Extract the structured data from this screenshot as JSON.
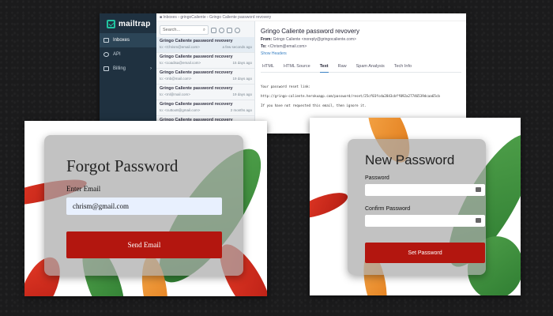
{
  "mailtrap": {
    "logo_text": "mailtrap",
    "breadcrumb": "■  Inboxes  ›  gringoCaliente  ›  Gringo Caliente password revovery",
    "nav": [
      {
        "label": "Inboxes"
      },
      {
        "label": "API"
      },
      {
        "label": "Billing"
      }
    ],
    "search_placeholder": "Search...",
    "messages": [
      {
        "subject": "Gringo Caliente password revovery",
        "to": "to: <Chrism@email.com>",
        "time": "a few seconds ago"
      },
      {
        "subject": "Gringo Caliente password recovery",
        "to": "to: <coadisa@email.com>",
        "time": "15 days ago"
      },
      {
        "subject": "Gringo Caliente password recovery",
        "to": "to: <mb@mail.com>",
        "time": "19 days ago"
      },
      {
        "subject": "Gringo Caliente password recovery",
        "to": "to: <ml@mail.com>",
        "time": "19 days ago"
      },
      {
        "subject": "Gringo Caliente password recovery",
        "to": "to: <cuttoo8@gmail.com>",
        "time": "2 months ago"
      },
      {
        "subject": "Gringo Caliente password recovery",
        "to": "",
        "time": ""
      }
    ],
    "detail": {
      "subject": "Gringo Caliente password revovery",
      "from_label": "From:",
      "from_value": "Gringo Caliente <noreply@gringocaliente.com>",
      "to_label": "To:",
      "to_value": "<Chrism@email.com>",
      "show_headers": "Show Headers",
      "tabs": [
        "HTML",
        "HTML Source",
        "Text",
        "Raw",
        "Spam Analysis",
        "Tech Info"
      ],
      "body_lines": [
        "Your password reset link:",
        "http://gringo-caliente.herokuapp.com/password/reset/25cf03fcda2843cbff092a27746539dcaa65cb",
        "If you have not requested this email, then ignore it."
      ]
    }
  },
  "forgot_password": {
    "title": "Forgot Password",
    "email_label": "Enter Email",
    "email_value": "chrism@gmail.com",
    "button_label": "Send Email"
  },
  "new_password": {
    "title": "New Password",
    "password_label": "Password",
    "confirm_label": "Confirm Password",
    "button_label": "Set Password"
  }
}
